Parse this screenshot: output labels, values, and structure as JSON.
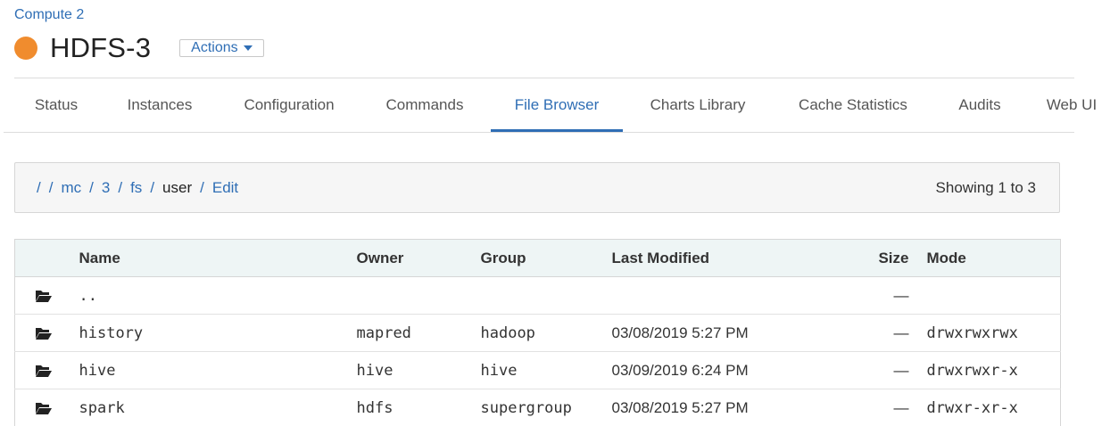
{
  "header": {
    "parent_link": "Compute 2",
    "service_name": "HDFS-3",
    "status_color": "#f08c2e",
    "actions_label": "Actions"
  },
  "tabs": [
    {
      "label": "Status",
      "active": false
    },
    {
      "label": "Instances",
      "active": false
    },
    {
      "label": "Configuration",
      "active": false
    },
    {
      "label": "Commands",
      "active": false
    },
    {
      "label": "File Browser",
      "active": true
    },
    {
      "label": "Charts Library",
      "active": false
    },
    {
      "label": "Cache Statistics",
      "active": false
    },
    {
      "label": "Audits",
      "active": false
    },
    {
      "label": "Web UI",
      "active": false
    }
  ],
  "path_bar": {
    "root": "/",
    "segments": [
      "mc",
      "3",
      "fs"
    ],
    "separator": "/",
    "current": "user",
    "edit_label": "Edit",
    "showing": "Showing 1 to 3"
  },
  "table": {
    "columns": {
      "name": "Name",
      "owner": "Owner",
      "group": "Group",
      "modified": "Last Modified",
      "size": "Size",
      "mode": "Mode"
    },
    "rows": [
      {
        "icon": "folder-open-icon",
        "name": "..",
        "owner": "",
        "group": "",
        "modified": "",
        "size": "—",
        "mode": ""
      },
      {
        "icon": "folder-open-icon",
        "name": "history",
        "owner": "mapred",
        "group": "hadoop",
        "modified": "03/08/2019 5:27 PM",
        "size": "—",
        "mode": "drwxrwxrwx"
      },
      {
        "icon": "folder-open-icon",
        "name": "hive",
        "owner": "hive",
        "group": "hive",
        "modified": "03/09/2019 6:24 PM",
        "size": "—",
        "mode": "drwxrwxr-x"
      },
      {
        "icon": "folder-open-icon",
        "name": "spark",
        "owner": "hdfs",
        "group": "supergroup",
        "modified": "03/08/2019 5:27 PM",
        "size": "—",
        "mode": "drwxr-xr-x"
      }
    ]
  },
  "colors": {
    "link": "#2f6eb5",
    "header_row_bg": "#eef5f5",
    "path_bar_bg": "#f6f6f6"
  }
}
